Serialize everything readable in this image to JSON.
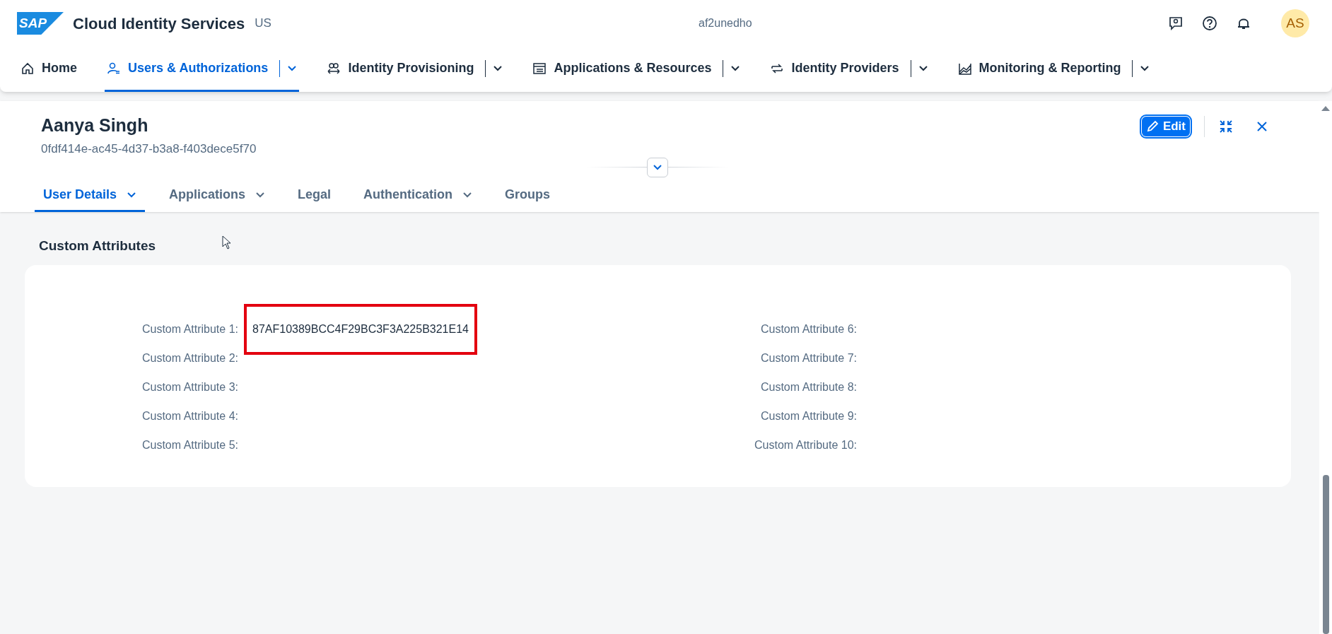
{
  "shell": {
    "logo": "SAP",
    "product": "Cloud Identity Services",
    "region": "US",
    "tenant": "af2unedho",
    "avatar": "AS"
  },
  "nav": [
    {
      "label": "Home",
      "kind": "home",
      "menu": false,
      "selected": false
    },
    {
      "label": "Users & Authorizations",
      "kind": "users",
      "menu": true,
      "selected": true
    },
    {
      "label": "Identity Provisioning",
      "kind": "provisioning",
      "menu": true,
      "selected": false
    },
    {
      "label": "Applications & Resources",
      "kind": "apps",
      "menu": true,
      "selected": false
    },
    {
      "label": "Identity Providers",
      "kind": "providers",
      "menu": true,
      "selected": false
    },
    {
      "label": "Monitoring & Reporting",
      "kind": "monitoring",
      "menu": true,
      "selected": false
    }
  ],
  "header": {
    "title": "Aanya Singh",
    "subtitle": "0fdf414e-ac45-4d37-b3a8-f403dece5f70",
    "edit_button": "Edit"
  },
  "tabs": [
    {
      "label": "User Details",
      "menu": true,
      "selected": true
    },
    {
      "label": "Applications",
      "menu": true,
      "selected": false
    },
    {
      "label": "Legal",
      "menu": false,
      "selected": false
    },
    {
      "label": "Authentication",
      "menu": true,
      "selected": false
    },
    {
      "label": "Groups",
      "menu": false,
      "selected": false
    }
  ],
  "section": {
    "title": "Custom Attributes",
    "columns": [
      [
        {
          "label": "Custom Attribute 1:",
          "value": "87AF10389BCC4F29BC3F3A225B321E14",
          "highlighted": true
        },
        {
          "label": "Custom Attribute 2:",
          "highlighted": false
        },
        {
          "label": "Custom Attribute 3:",
          "highlighted": false
        },
        {
          "label": "Custom Attribute 4:",
          "highlighted": false
        },
        {
          "label": "Custom Attribute 5:",
          "highlighted": false
        }
      ],
      [
        {
          "label": "Custom Attribute 6:",
          "highlighted": false
        },
        {
          "label": "Custom Attribute 7:",
          "highlighted": false
        },
        {
          "label": "Custom Attribute 8:",
          "highlighted": false
        },
        {
          "label": "Custom Attribute 9:",
          "highlighted": false
        },
        {
          "label": "Custom Attribute 10:",
          "highlighted": false
        }
      ]
    ]
  }
}
